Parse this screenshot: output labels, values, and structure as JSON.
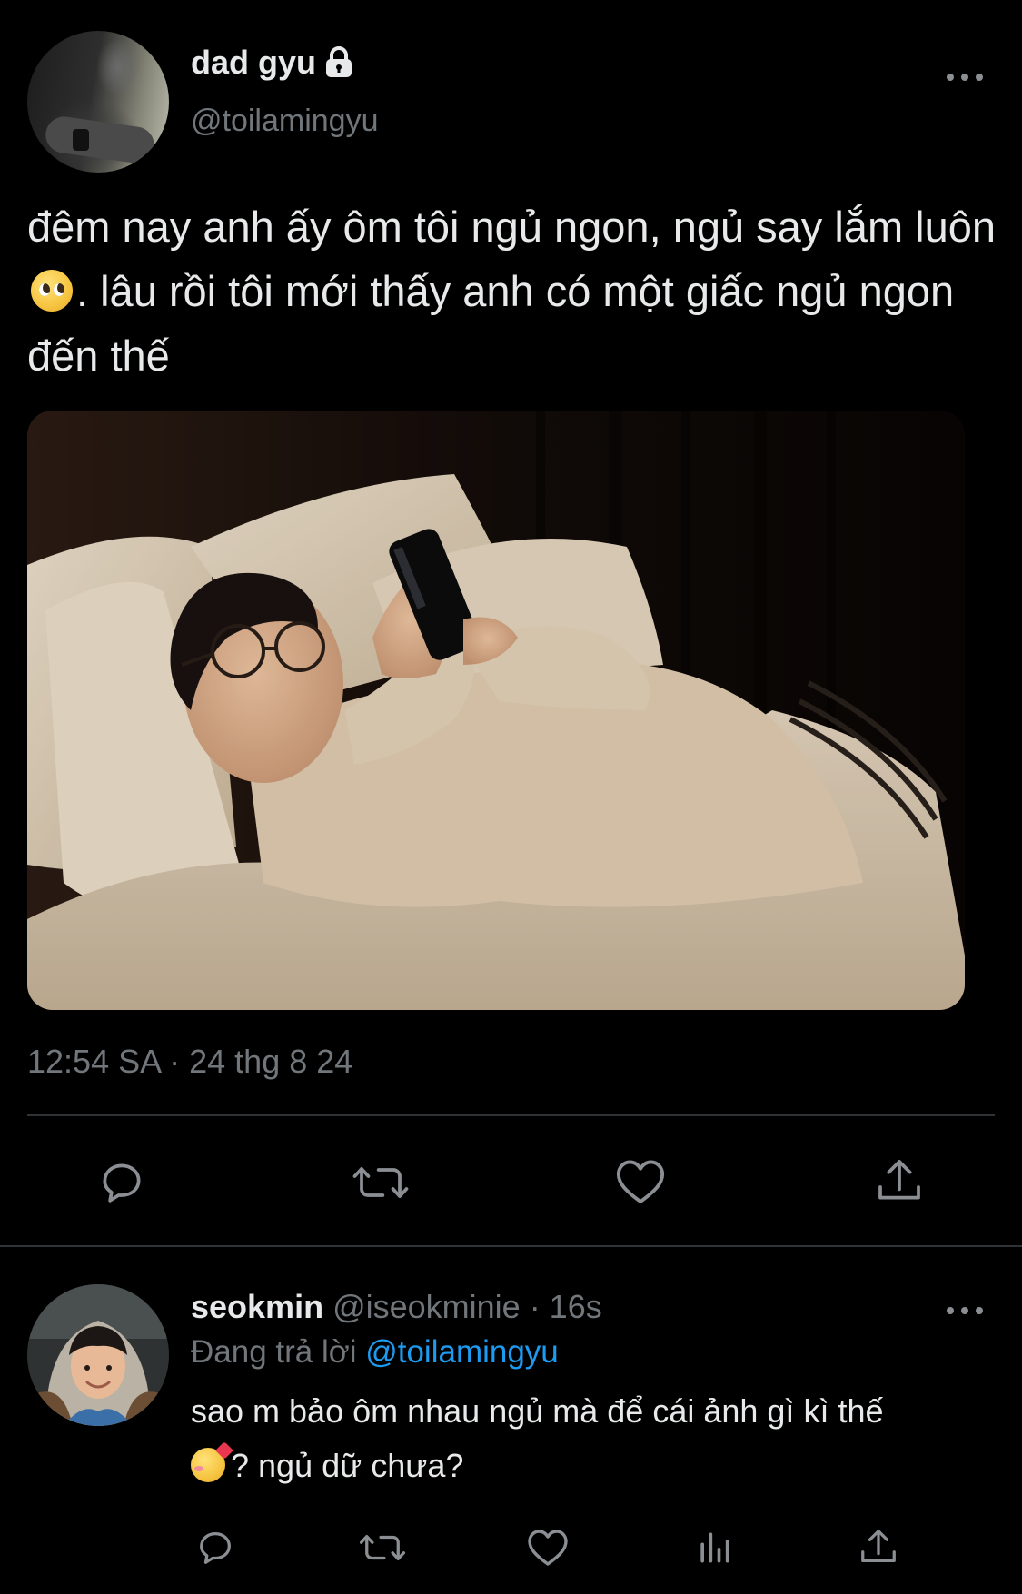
{
  "tweet": {
    "display_name": "dad gyu",
    "handle": "@toilamingyu",
    "text": "đêm nay anh ấy ôm tôi ngủ ngon, ngủ say lắm luôn",
    "text_after_emoji": ". lâu rồi tôi mới thấy anh có một giấc ngủ ngon đến thế",
    "timestamp": "12:54 SA · 24 thg 8 24"
  },
  "reply": {
    "display_name": "seokmin",
    "meta": "@iseokminie · 16s",
    "replying_prefix": "Đang trả lời",
    "replying_to": "@toilamingyu",
    "text": "sao m bảo ôm nhau ngủ mà để cái ảnh gì kì thế",
    "text_after_emoji": "? ngủ dữ chưa?"
  },
  "icons": {
    "verified_lock": "lock-icon",
    "more": "more-icon",
    "reply": "reply-icon",
    "retweet": "retweet-icon",
    "like": "heart-icon",
    "share": "share-icon",
    "analytics": "analytics-icon"
  },
  "colors": {
    "background": "#000000",
    "text_primary": "#e7e9ea",
    "text_secondary": "#71767b",
    "link": "#1d9bf0",
    "divider": "#2f3336"
  }
}
